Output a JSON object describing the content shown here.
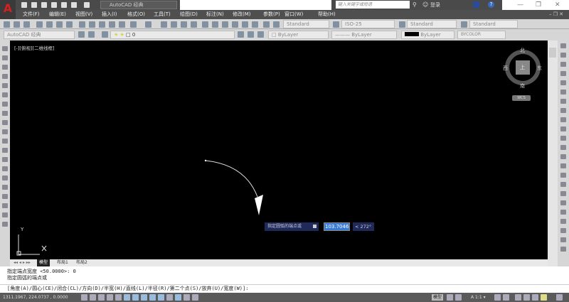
{
  "app": {
    "logo_text": "A",
    "workspace": "AutoCAD 经典",
    "search_placeholder": "键入关键字或短语",
    "login": "登录",
    "help": "?",
    "minimize": "—",
    "restore": "❐",
    "close": "✕"
  },
  "menu": [
    "文件(F)",
    "编辑(E)",
    "视图(V)",
    "插入(I)",
    "格式(O)",
    "工具(T)",
    "绘图(D)",
    "标注(N)",
    "修改(M)",
    "参数(P)",
    "窗口(W)",
    "帮助(H)"
  ],
  "styles": {
    "text_style": "Standard",
    "dim_style": "ISO-25",
    "table_style": "Standard",
    "mleader_style": "Standard"
  },
  "layers": {
    "workspace": "AutoCAD 经典",
    "layer": "0",
    "color": "ByLayer",
    "linetype": "ByLayer",
    "lineweight": "ByLayer",
    "plotstyle": "BYCOLOR"
  },
  "viewport": {
    "label": "[-][俯视][二维线框]",
    "ucs_y": "Y",
    "ucs_x": "X"
  },
  "viewcube": {
    "north": "北",
    "south": "南",
    "east": "东",
    "west": "西",
    "face": "上",
    "ucs": "WCS"
  },
  "dynamic_input": {
    "prompt": "指定圆弧的端点或",
    "value": "103.7046",
    "angle": "< 272°"
  },
  "tabs": [
    "模型",
    "布局1",
    "布局2"
  ],
  "command": {
    "history": [
      "指定端点宽度 <50.0000>: 0",
      "指定圆弧的端点或"
    ],
    "prompt": "[角度(A)/圆心(CE)/闭合(CL)/方向(D)/半宽(H)/直线(L)/半径(R)/第二个点(S)/放弃(U)/宽度(W)]:"
  },
  "status": {
    "coords": "1311.1967, 224.0737 , 0.0000",
    "model": "模型",
    "annotation_scale": "A 1:1 ▾"
  },
  "colors": {
    "accent": "#d42020",
    "canvas": "#000000",
    "selection": "#3a7bd5"
  }
}
